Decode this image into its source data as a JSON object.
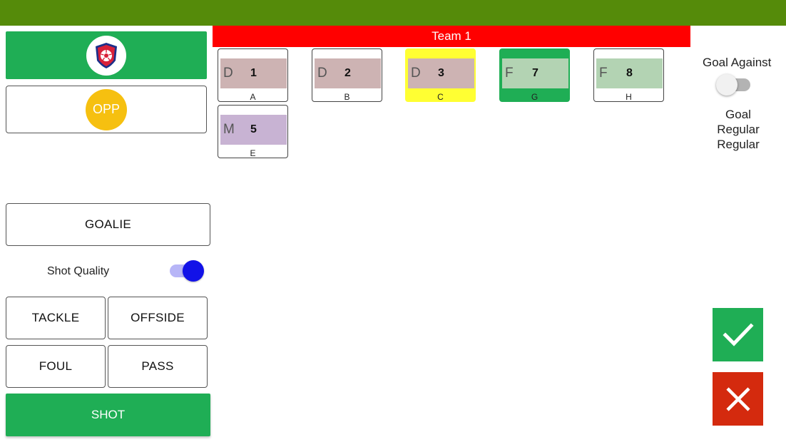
{
  "team_header": "Team 1",
  "opponent": {
    "label": "OPP"
  },
  "actions": {
    "goalie": "GOALIE",
    "shot_quality": "Shot Quality",
    "tackle": "TACKLE",
    "offside": "OFFSIDE",
    "foul": "FOUL",
    "pass": "PASS",
    "shot": "SHOT"
  },
  "players": [
    {
      "pos": "D",
      "num": "1",
      "letter": "A",
      "card_bg": "#ffffff",
      "inner_bg": "#cdb3b3"
    },
    {
      "pos": "D",
      "num": "2",
      "letter": "B",
      "card_bg": "#ffffff",
      "inner_bg": "#cdb3b3"
    },
    {
      "pos": "D",
      "num": "3",
      "letter": "C",
      "card_bg": "#ffff33",
      "inner_bg": "#cdb3b3"
    },
    {
      "pos": "F",
      "num": "7",
      "letter": "G",
      "card_bg": "#1fae55",
      "inner_bg": "#b3d3b3"
    },
    {
      "pos": "F",
      "num": "8",
      "letter": "H",
      "card_bg": "#ffffff",
      "inner_bg": "#b3d3b3"
    },
    {
      "pos": "M",
      "num": "5",
      "letter": "E",
      "card_bg": "#ffffff",
      "inner_bg": "#c8b3d3"
    }
  ],
  "right_panel": {
    "goal_against": "Goal Against",
    "status_lines": [
      "Goal",
      "Regular",
      "Regular"
    ]
  },
  "toggles": {
    "shot_quality_on": true,
    "goal_against_on": false
  },
  "colors": {
    "top_bar": "#558b0a",
    "team_header": "#ff0000",
    "primary_green": "#1fae55",
    "cancel_red": "#d42a0e",
    "opp_yellow": "#f6c010",
    "toggle_on": "#1212e8"
  },
  "icons": {
    "team_logo": "shield-ball-icon",
    "confirm": "checkmark-icon",
    "cancel": "close-icon"
  }
}
